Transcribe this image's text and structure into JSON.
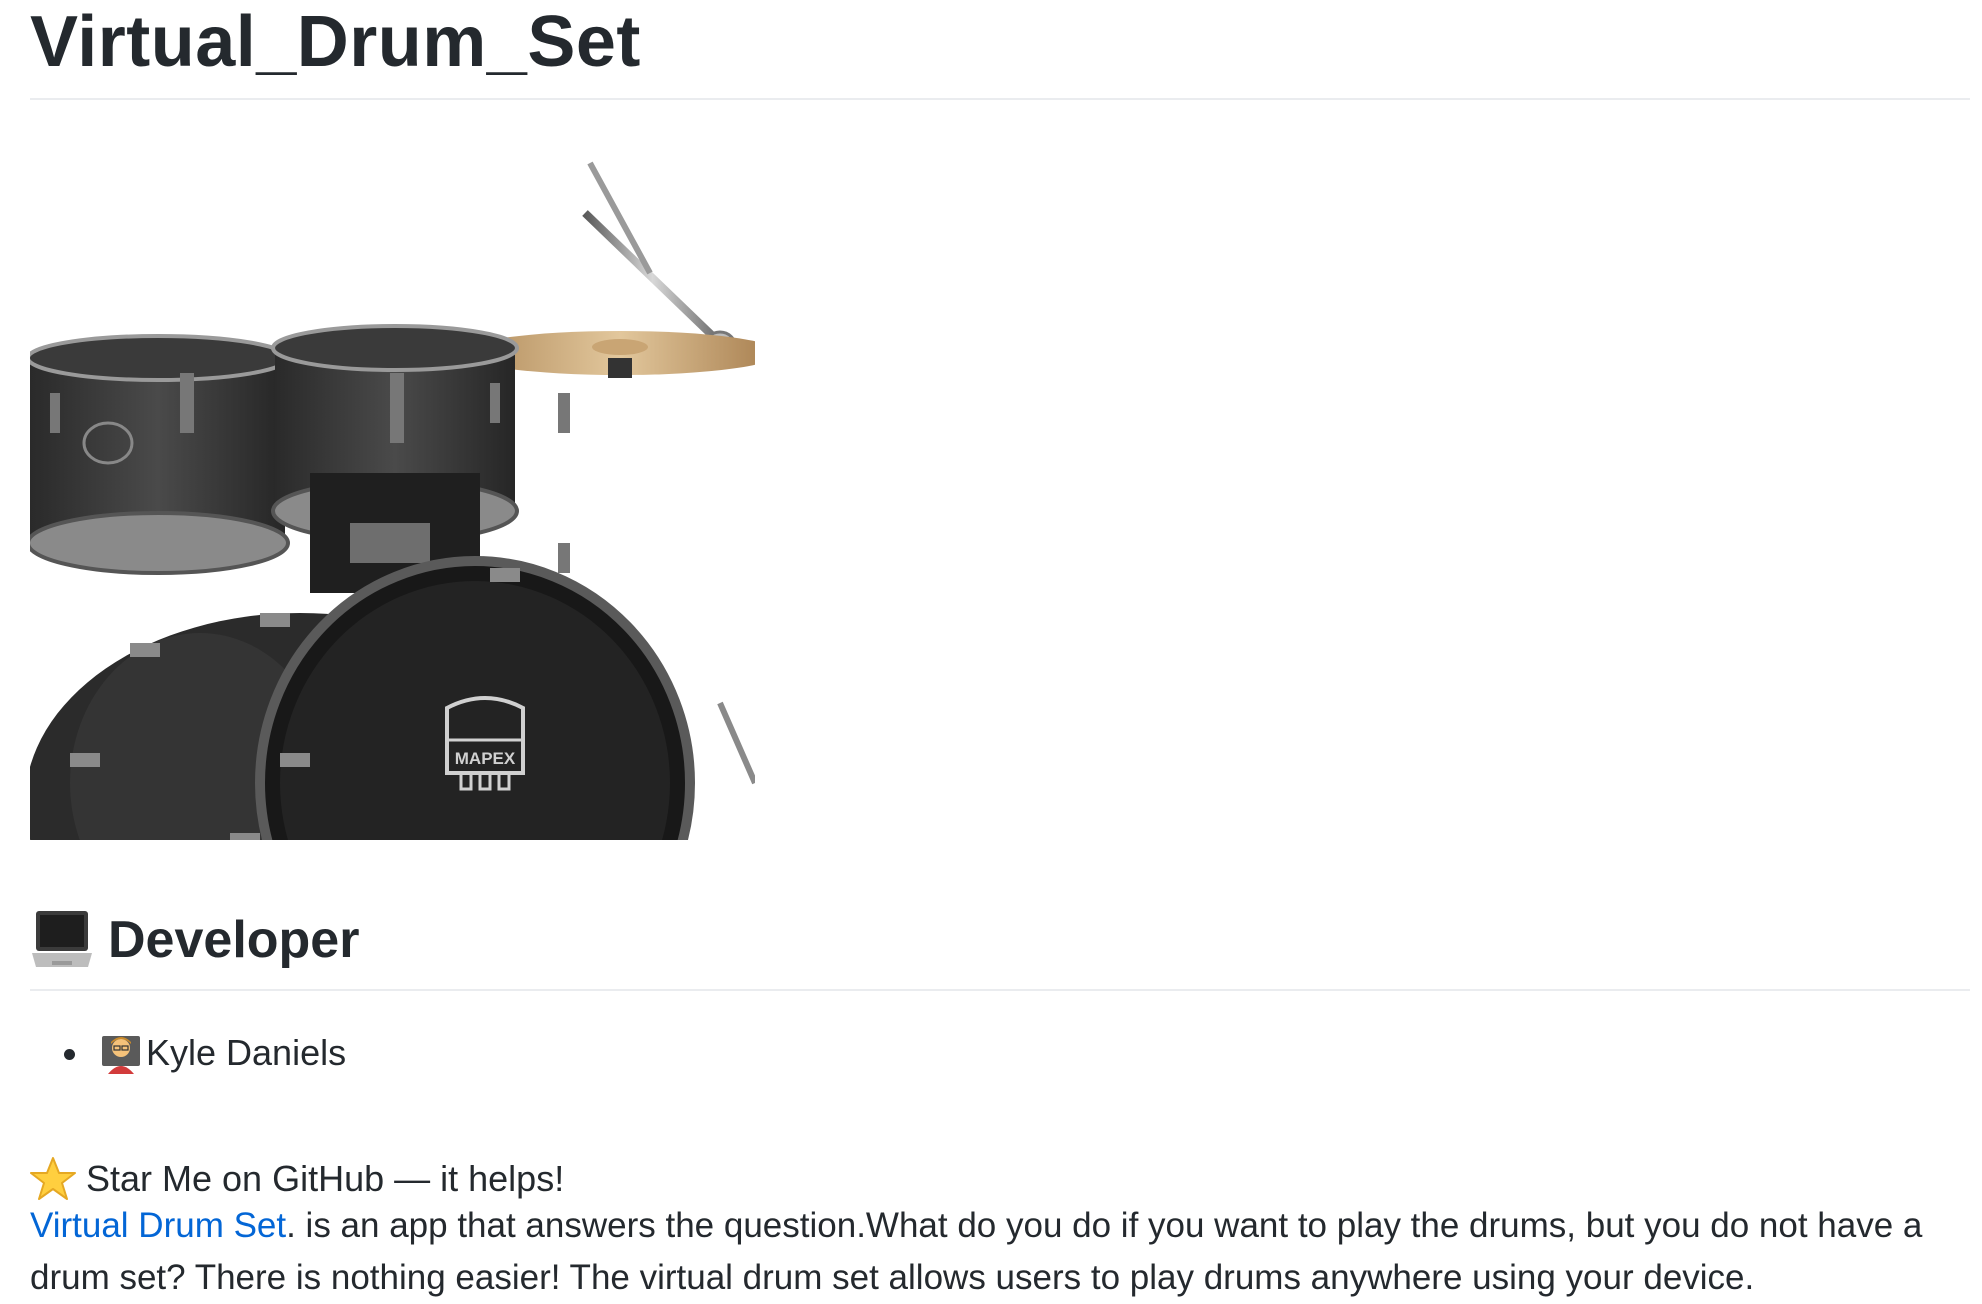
{
  "title": "Virtual_Drum_Set",
  "hero_image": {
    "logo_text": "MAPEX"
  },
  "developer_section": {
    "heading": "Developer",
    "icon": "laptop-icon",
    "developers": [
      {
        "icon": "technologist-icon",
        "name": "Kyle Daniels"
      }
    ]
  },
  "star_line": {
    "icon": "star-icon",
    "text": "Star Me on GitHub — it helps!"
  },
  "description": {
    "link_text": "Virtual Drum Set",
    "text": ". is an app that answers the question.What do you do if you want to play the drums, but you do not have a drum set? There is nothing easier! The virtual drum set allows users to play drums anywhere using your device."
  },
  "colors": {
    "text": "#24292e",
    "link": "#0366d6",
    "rule": "#eaecef"
  }
}
